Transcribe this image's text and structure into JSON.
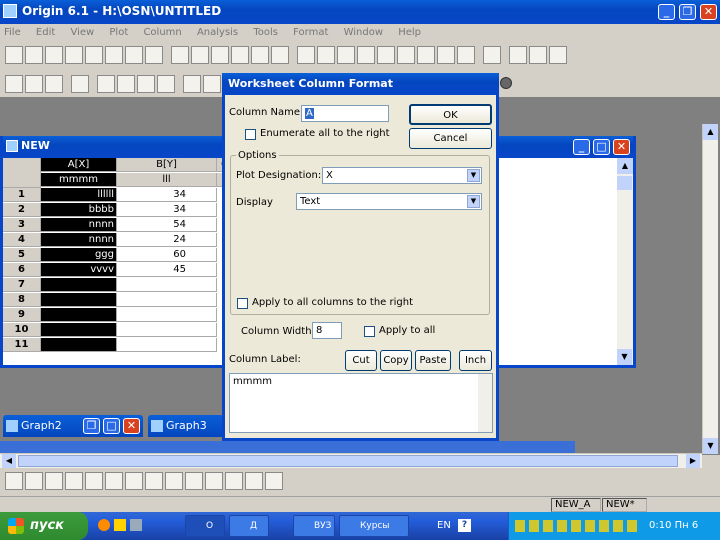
{
  "app": {
    "title": "Origin 6.1 - H:\\OSN\\UNTITLED",
    "menu": [
      "File",
      "Edit",
      "View",
      "Plot",
      "Column",
      "Analysis",
      "Tools",
      "Format",
      "Window",
      "Help"
    ]
  },
  "worksheet": {
    "title": "NEW",
    "col_a_header": "A[X]",
    "col_a_label": "mmmm",
    "col_b_header": "B[Y]",
    "col_b_label": "lll",
    "col_c_header": "C[",
    "rows": [
      {
        "n": "1",
        "a": "llllll",
        "b": "34"
      },
      {
        "n": "2",
        "a": "bbbb",
        "b": "34"
      },
      {
        "n": "3",
        "a": "nnnn",
        "b": "54"
      },
      {
        "n": "4",
        "a": "nnnn",
        "b": "24"
      },
      {
        "n": "5",
        "a": "ggg",
        "b": "60"
      },
      {
        "n": "6",
        "a": "vvvv",
        "b": "45"
      },
      {
        "n": "7",
        "a": "",
        "b": ""
      },
      {
        "n": "8",
        "a": "",
        "b": ""
      },
      {
        "n": "9",
        "a": "",
        "b": ""
      },
      {
        "n": "10",
        "a": "",
        "b": ""
      },
      {
        "n": "11",
        "a": "",
        "b": ""
      }
    ]
  },
  "dialog": {
    "title": "Worksheet Column Format",
    "column_name_label": "Column Name:",
    "column_name_value": "A",
    "enumerate_label": "Enumerate all to the right",
    "ok": "OK",
    "cancel": "Cancel",
    "options_label": "Options",
    "plot_designation_label": "Plot Designation:",
    "plot_designation_value": "X",
    "display_label": "Display",
    "display_value": "Text",
    "apply_right_label": "Apply to all columns to the right",
    "column_width_label": "Column Width:",
    "column_width_value": "8",
    "apply_all_label": "Apply to all",
    "column_label_label": "Column Label:",
    "cut": "Cut",
    "copy": "Copy",
    "paste": "Paste",
    "inch": "Inch",
    "label_text": "mmmm"
  },
  "graphs": [
    {
      "title": "Graph2"
    },
    {
      "title": "Graph3"
    }
  ],
  "status": {
    "cell1": "NEW_A",
    "cell2": "NEW*"
  },
  "taskbar": {
    "start": "пуск",
    "tasks": [
      "O",
      "Д",
      "ВУЗ",
      "Курсы"
    ],
    "lang": "EN",
    "clock": "0:10 Пн 6"
  }
}
